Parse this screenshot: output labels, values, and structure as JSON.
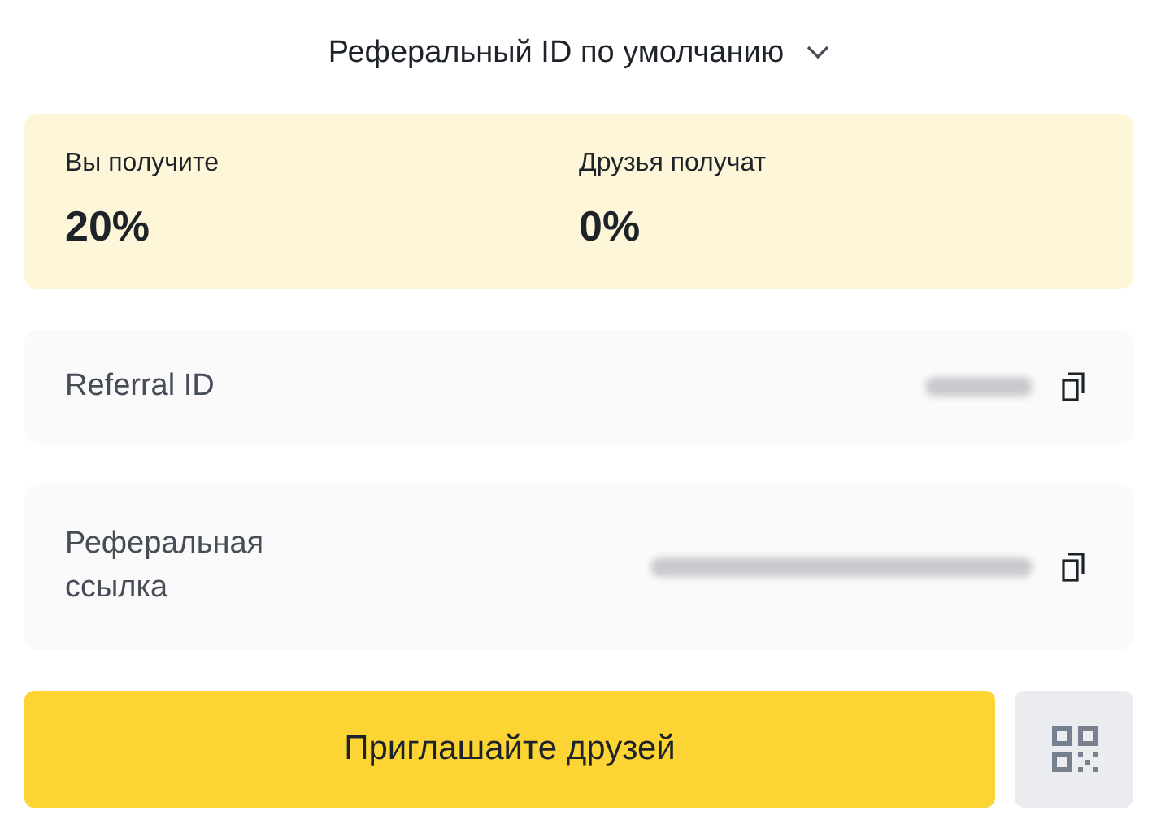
{
  "header": {
    "title": "Реферальный ID по умолчанию"
  },
  "commission": [
    {
      "label": "Вы получите",
      "value": "20%"
    },
    {
      "label": "Друзья получат",
      "value": "0%"
    }
  ],
  "fields": [
    {
      "label": "Referral ID",
      "kind": "id"
    },
    {
      "label": "Реферальная ссылка",
      "kind": "link"
    }
  ],
  "invite_button": {
    "label": "Приглашайте друзей"
  }
}
